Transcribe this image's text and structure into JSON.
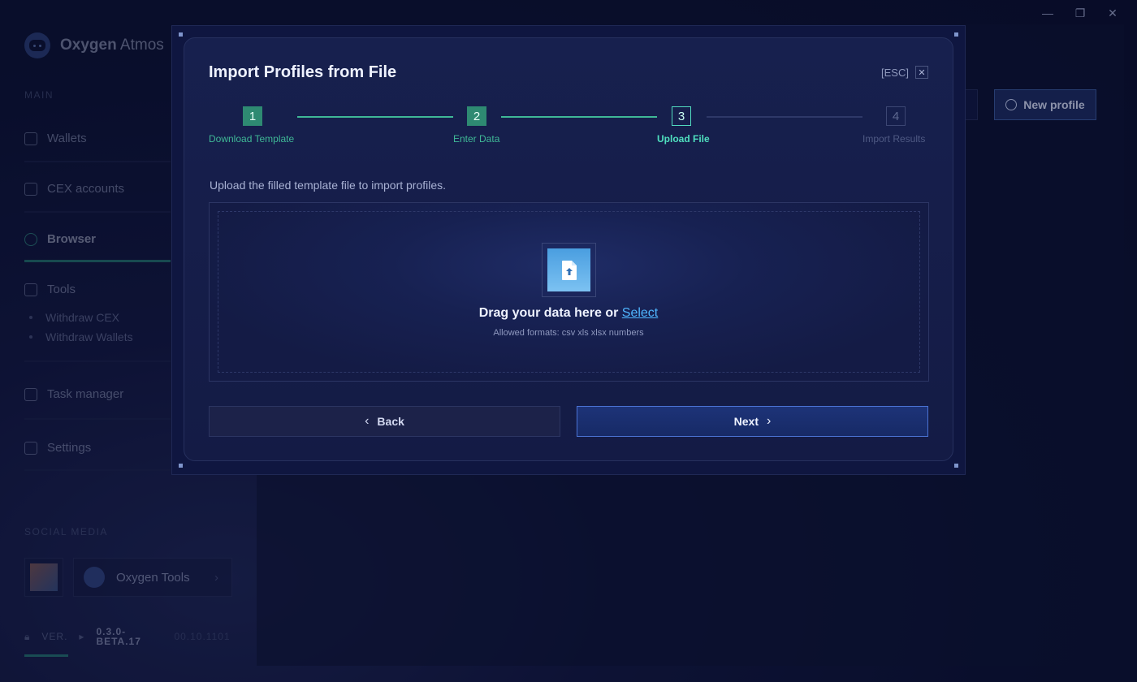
{
  "window": {
    "minimize_icon": "minimize-icon",
    "maximize_icon": "restore-icon",
    "close_icon": "close-icon",
    "minimize": "—",
    "restore": "❐",
    "close": "✕"
  },
  "sidebar": {
    "brand_bold": "Oxygen",
    "brand_light": " Atmos",
    "main_label": "MAIN",
    "items": [
      {
        "label": "Wallets",
        "icon": "wallet-icon"
      },
      {
        "label": "CEX accounts",
        "icon": "layers-icon"
      },
      {
        "label": "Browser",
        "icon": "globe-icon",
        "active": true
      },
      {
        "label": "Tools",
        "icon": "tools-icon"
      },
      {
        "label": "Task manager",
        "icon": "task-icon"
      },
      {
        "label": "Settings",
        "icon": "sliders-icon"
      }
    ],
    "sub_items": [
      "Withdraw CEX",
      "Withdraw Wallets"
    ],
    "social_label": "SOCIAL MEDIA",
    "tools_card": "Oxygen Tools",
    "version_label": "VER.",
    "version_value": "0.3.0-BETA.17",
    "version_date": "00.10.1101"
  },
  "header": {
    "new_profile": "New profile"
  },
  "modal": {
    "title": "Import Profiles from File",
    "esc": "[ESC]",
    "close": "✕",
    "steps": [
      {
        "num": "1",
        "label": "Download Template",
        "state": "done"
      },
      {
        "num": "2",
        "label": "Enter Data",
        "state": "done"
      },
      {
        "num": "3",
        "label": "Upload File",
        "state": "current"
      },
      {
        "num": "4",
        "label": "Import Results",
        "state": "todo"
      }
    ],
    "hint": "Upload the filled template file to import profiles.",
    "drag_text": "Drag your data here or ",
    "select_link": "Select",
    "formats": "Allowed formats: csv xls xlsx numbers",
    "back": "Back",
    "next": "Next"
  },
  "colors": {
    "accent": "#3fb896",
    "link": "#4fb6ff",
    "next_border": "#4b73d4"
  }
}
